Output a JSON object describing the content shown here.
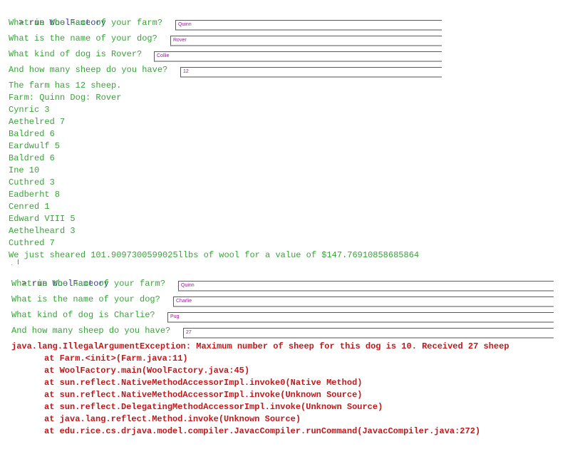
{
  "session1": {
    "prompt": "> run ",
    "command": "WoolFactory",
    "questions": [
      {
        "label": "What is the name of your farm?",
        "value": "Quinn"
      },
      {
        "label": "What is the name of your dog?",
        "value": "Rover"
      },
      {
        "label": "What kind of dog is Rover?",
        "value": "Collie"
      },
      {
        "label": "And how many sheep do you have?",
        "value": "12"
      }
    ],
    "output": [
      "The farm has 12 sheep.",
      "Farm: Quinn Dog: Rover",
      "Cynric 3",
      "Aethelred 7",
      "Baldred 6",
      "Eardwulf 5",
      "Baldred 6",
      "Ine 10",
      "Cuthred 3",
      "Eadberht 8",
      "Cenred 1",
      "Edward VIII 5",
      "Aethelheard 3",
      "Cuthred 7",
      "We just sheared 101.9097300599025llbs of wool for a value of $147.76910858685864"
    ]
  },
  "session2": {
    "prompt": "> run ",
    "command": "WoolFactory",
    "questions": [
      {
        "label": "What is the name of your farm?",
        "value": "Quinn"
      },
      {
        "label": "What is the name of your dog?",
        "value": "Charlie"
      },
      {
        "label": "What kind of dog is Charlie?",
        "value": "Pug"
      },
      {
        "label": "And how many sheep do you have?",
        "value": "27"
      }
    ],
    "error": {
      "message": "java.lang.IllegalArgumentException: Maximum number of sheep for this dog is 10. Received 27 sheep",
      "stack": [
        "at Farm.<init>(Farm.java:11)",
        "at WoolFactory.main(WoolFactory.java:45)",
        "at sun.reflect.NativeMethodAccessorImpl.invoke0(Native Method)",
        "at sun.reflect.NativeMethodAccessorImpl.invoke(Unknown Source)",
        "at sun.reflect.DelegatingMethodAccessorImpl.invoke(Unknown Source)",
        "at java.lang.reflect.Method.invoke(Unknown Source)",
        "at edu.rice.cs.drjava.model.compiler.JavacCompiler.runCommand(JavacCompiler.java:272)"
      ]
    }
  }
}
